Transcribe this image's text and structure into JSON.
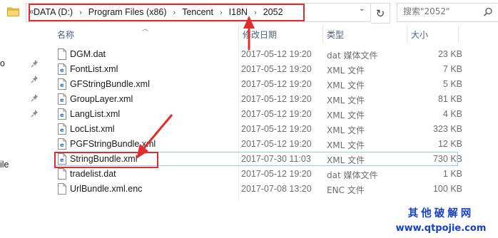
{
  "address_bar": {
    "overflow_label": "«",
    "breadcrumbs": [
      "DATA (D:)",
      "Program Files (x86)",
      "Tencent",
      "I18N",
      "2052"
    ],
    "separator": "›",
    "dropdown_glyph": "⌄",
    "refresh_glyph": "↻",
    "search_placeholder": "搜索\"2052\""
  },
  "nav_pane": {
    "fragments": [
      "o",
      "ile"
    ]
  },
  "columns": {
    "name": "名称",
    "date": "修改日期",
    "type": "类型",
    "size": "大小"
  },
  "files": [
    {
      "name": "DGM.dat",
      "date": "2017-05-12 19:20",
      "type": "dat 媒体文件",
      "size": "23 KB",
      "icon": "generic-file-icon"
    },
    {
      "name": "FontList.xml",
      "date": "2017-05-12 19:20",
      "type": "XML 文件",
      "size": "7 KB",
      "icon": "xml-file-icon"
    },
    {
      "name": "GFStringBundle.xml",
      "date": "2017-05-12 19:20",
      "type": "XML 文件",
      "size": "5 KB",
      "icon": "xml-file-icon"
    },
    {
      "name": "GroupLayer.xml",
      "date": "2017-05-12 19:20",
      "type": "XML 文件",
      "size": "81 KB",
      "icon": "xml-file-icon"
    },
    {
      "name": "LangList.xml",
      "date": "2017-05-12 19:20",
      "type": "XML 文件",
      "size": "4 KB",
      "icon": "xml-file-icon"
    },
    {
      "name": "LocList.xml",
      "date": "2017-05-12 19:20",
      "type": "XML 文件",
      "size": "323 KB",
      "icon": "xml-file-icon"
    },
    {
      "name": "PGFStringBundle.xml",
      "date": "2017-05-12 19:20",
      "type": "XML 文件",
      "size": "12 KB",
      "icon": "xml-file-icon"
    },
    {
      "name": "StringBundle.xml",
      "date": "2017-07-30 11:03",
      "type": "XML 文件",
      "size": "730 KB",
      "icon": "xml-file-icon"
    },
    {
      "name": "tradelist.dat",
      "date": "2017-05-12 19:20",
      "type": "dat 媒体文件",
      "size": "1 KB",
      "icon": "generic-file-icon"
    },
    {
      "name": "UrlBundle.xml.enc",
      "date": "2017-07-08 13:20",
      "type": "ENC 文件",
      "size": "100 KB",
      "icon": "generic-file-icon"
    }
  ],
  "watermark": {
    "line1": "其他破解网",
    "line2": "www.qtpojie.com"
  },
  "colors": {
    "annotation_red": "#e02d2d",
    "watermark_blue": "#1540c8",
    "header_text": "#4c607a",
    "folder_yellow": "#f0c342"
  }
}
